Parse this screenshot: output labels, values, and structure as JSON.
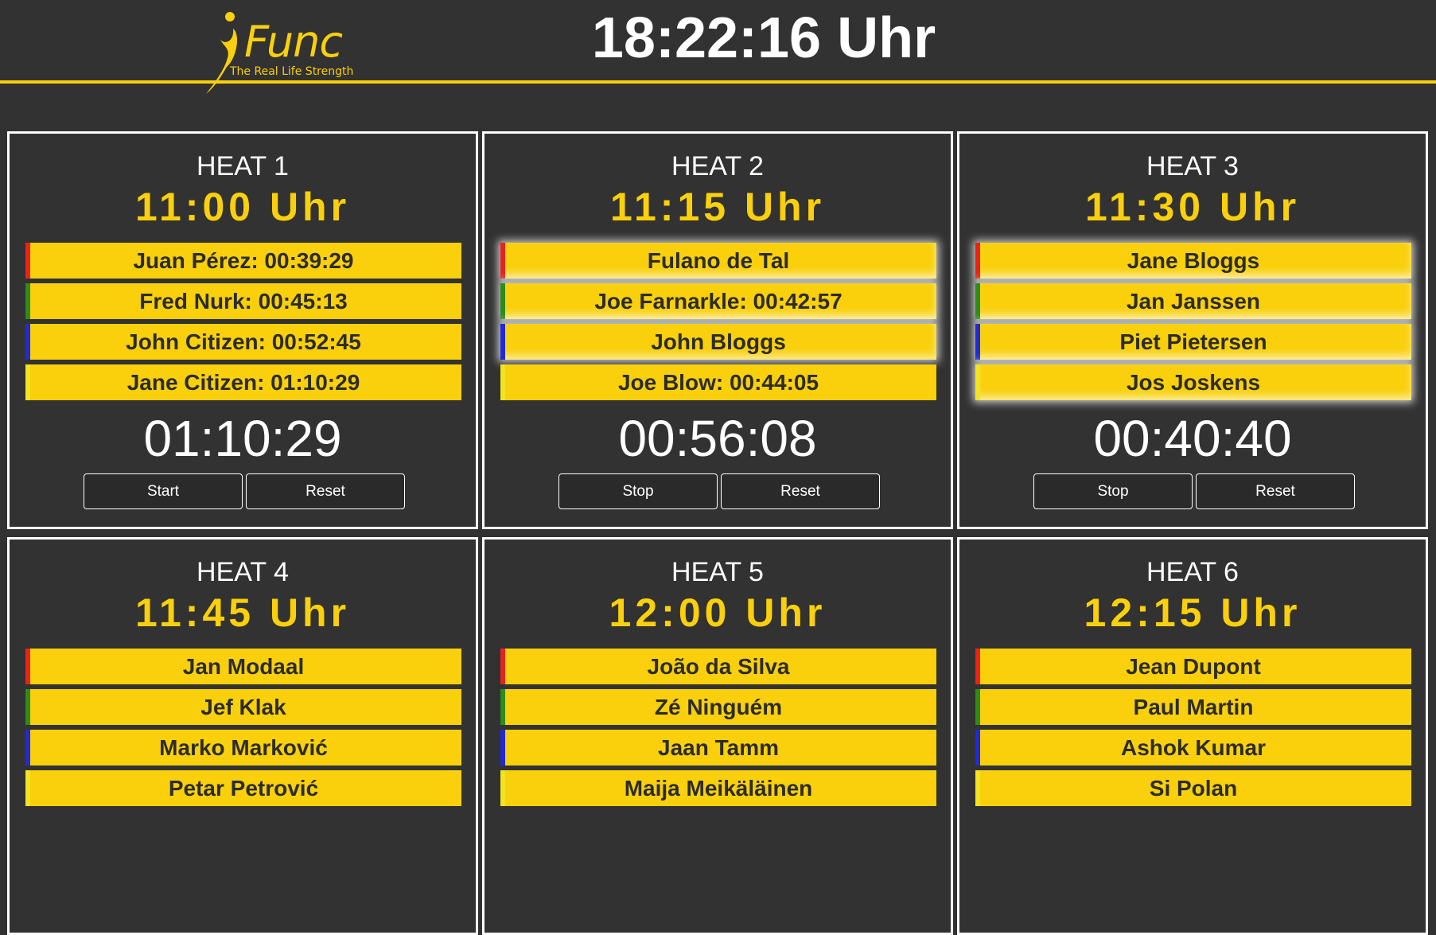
{
  "header": {
    "logo": {
      "name": "Func",
      "tagline": "The Real Life Strength"
    },
    "clock": "18:22:16 Uhr"
  },
  "colors": {
    "accent": "#f9d00b",
    "background": "#323232",
    "lane_colors": [
      "#e8231e",
      "#2e8b1e",
      "#1f2bd8",
      "#f2e420"
    ]
  },
  "heats": [
    {
      "title": "HEAT 1",
      "time": "11:00 Uhr",
      "athletes": [
        "Juan Pérez: 00:39:29",
        "Fred Nurk: 00:45:13",
        "John Citizen: 00:52:45",
        "Jane Citizen: 01:10:29"
      ],
      "highlighted": [],
      "timer": "01:10:29",
      "buttons": [
        "Start",
        "Reset"
      ]
    },
    {
      "title": "HEAT 2",
      "time": "11:15 Uhr",
      "athletes": [
        "Fulano de Tal",
        "Joe Farnarkle: 00:42:57",
        "John Bloggs",
        "Joe Blow: 00:44:05"
      ],
      "highlighted": [
        0,
        1,
        2
      ],
      "timer": "00:56:08",
      "buttons": [
        "Stop",
        "Reset"
      ]
    },
    {
      "title": "HEAT 3",
      "time": "11:30 Uhr",
      "athletes": [
        "Jane Bloggs",
        "Jan Janssen",
        "Piet Pietersen",
        "Jos Joskens"
      ],
      "highlighted": [
        0,
        1,
        2,
        3
      ],
      "timer": "00:40:40",
      "buttons": [
        "Stop",
        "Reset"
      ]
    },
    {
      "title": "HEAT 4",
      "time": "11:45 Uhr",
      "athletes": [
        "Jan Modaal",
        "Jef Klak",
        "Marko Marković",
        "Petar Petrović"
      ],
      "highlighted": [],
      "timer": "",
      "buttons": []
    },
    {
      "title": "HEAT 5",
      "time": "12:00 Uhr",
      "athletes": [
        "João da Silva",
        "Zé Ninguém",
        "Jaan Tamm",
        "Maija Meikäläinen"
      ],
      "highlighted": [],
      "timer": "",
      "buttons": []
    },
    {
      "title": "HEAT 6",
      "time": "12:15 Uhr",
      "athletes": [
        "Jean Dupont",
        "Paul Martin",
        "Ashok Kumar",
        "Si Polan"
      ],
      "highlighted": [],
      "timer": "",
      "buttons": []
    }
  ]
}
